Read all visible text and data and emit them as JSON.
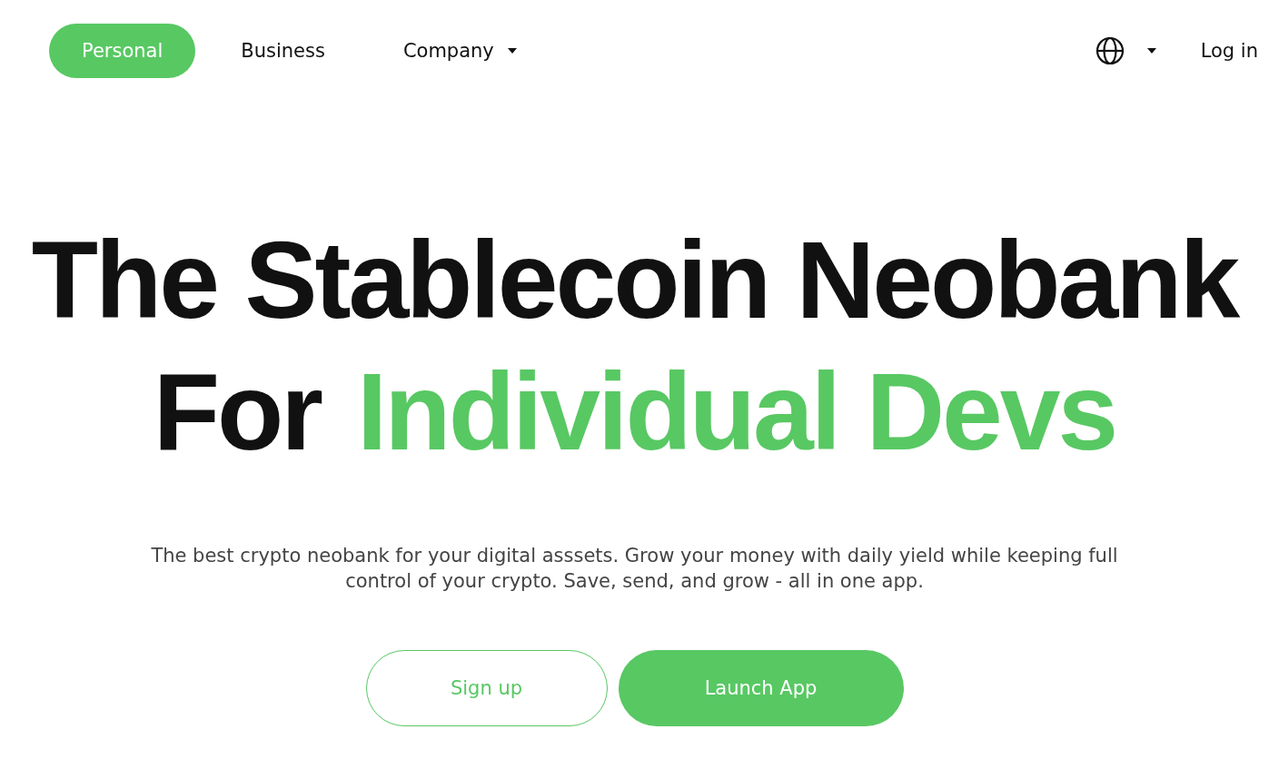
{
  "nav": {
    "tabs": [
      {
        "label": "Personal",
        "selected": true,
        "dropdown": false
      },
      {
        "label": "Business",
        "selected": false,
        "dropdown": false
      },
      {
        "label": "Company",
        "selected": false,
        "dropdown": true
      }
    ],
    "login": "Log in"
  },
  "hero": {
    "title_line_1": "The Stablecoin Neobank",
    "title_line_2": [
      {
        "text": "For",
        "highlighted": false
      },
      {
        "text": "Individual Devs",
        "highlighted": true
      }
    ],
    "description": "The best crypto neobank for your digital asssets. Grow your money with daily yield while keeping full control of your crypto. Save, send, and grow - all in one app.",
    "buttons": [
      {
        "label": "Sign up",
        "kind": "outline"
      },
      {
        "label": "Launch App",
        "kind": "filled"
      }
    ]
  }
}
